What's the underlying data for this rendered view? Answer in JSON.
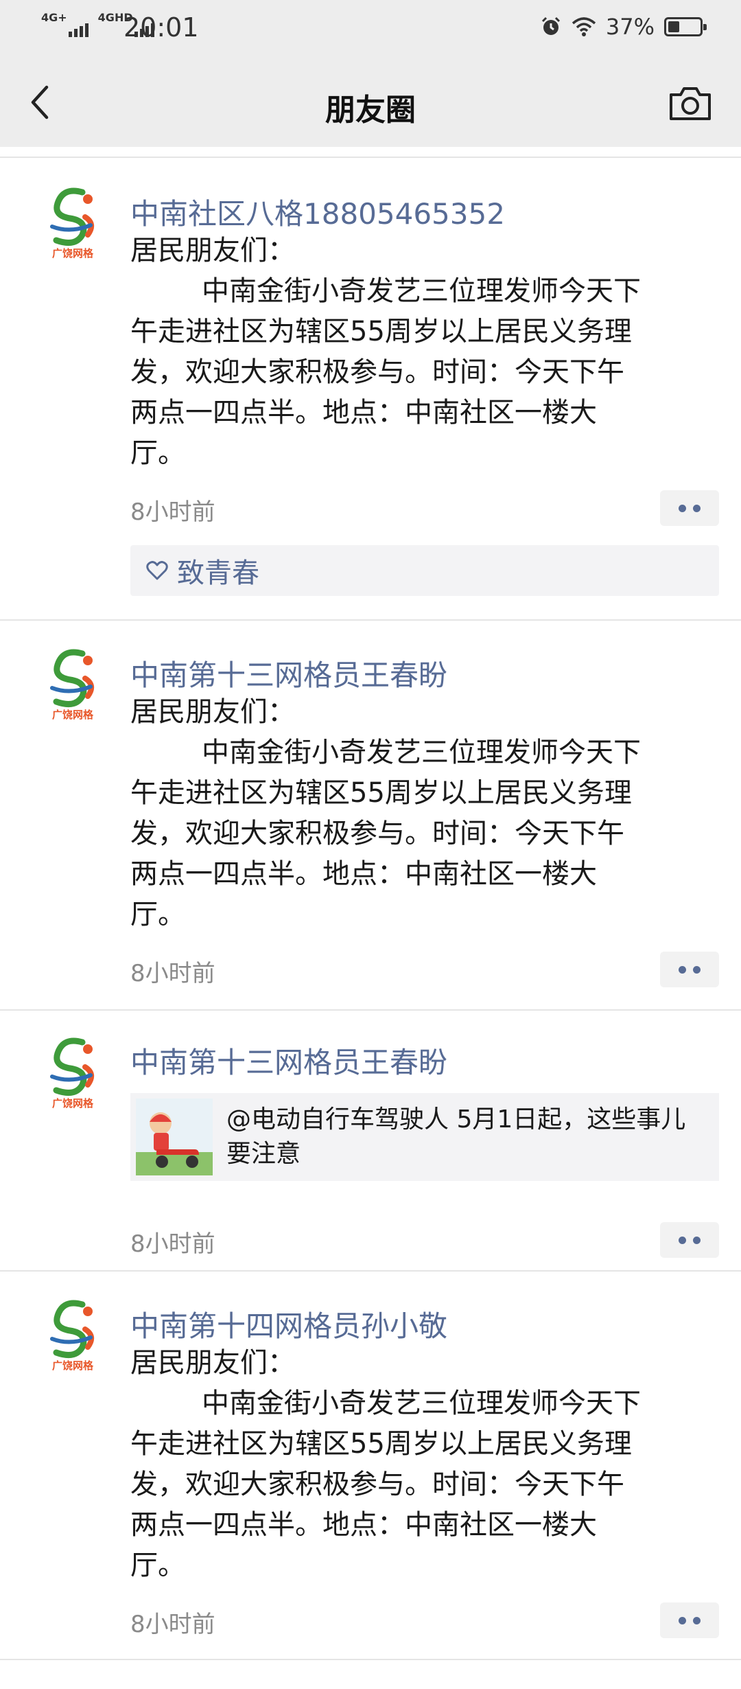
{
  "status_bar": {
    "network_1": "4G+",
    "network_2": "4GHD",
    "time": "20:01",
    "battery_percent": "37%",
    "battery_level": 0.37,
    "icons": [
      "alarm-icon",
      "wifi-icon",
      "battery-icon"
    ]
  },
  "nav": {
    "title": "朋友圈",
    "back_icon": "chevron-left-icon",
    "camera_icon": "camera-icon"
  },
  "colors": {
    "author_link": "#576b95",
    "header_bg": "#ededed",
    "timestamp": "#8a8a8a"
  },
  "avatar_text": "广饶网格",
  "posts": [
    {
      "author": "中南社区八格18805465352",
      "greeting": "居民朋友们：",
      "lines": [
        "中南金街小奇发艺三位理发师今天下",
        "午走进社区为辖区55周岁以上居民义务理",
        "发，欢迎大家积极参与。时间：今天下午",
        "两点一四点半。地点：中南社区一楼大",
        "厅。"
      ],
      "time": "8小时前",
      "likes": "致青春"
    },
    {
      "author": "中南第十三网格员王春盼",
      "greeting": "居民朋友们：",
      "lines": [
        "中南金街小奇发艺三位理发师今天下",
        "午走进社区为辖区55周岁以上居民义务理",
        "发，欢迎大家积极参与。时间：今天下午",
        "两点一四点半。地点：中南社区一楼大",
        "厅。"
      ],
      "time": "8小时前"
    },
    {
      "author": "中南第十三网格员王春盼",
      "share_lines": [
        "@电动自行车驾驶人 5月1日起，这些事儿",
        "要注意"
      ],
      "time": "8小时前"
    },
    {
      "author": "中南第十四网格员孙小敬",
      "greeting": "居民朋友们：",
      "lines": [
        "中南金街小奇发艺三位理发师今天下",
        "午走进社区为辖区55周岁以上居民义务理",
        "发，欢迎大家积极参与。时间：今天下午",
        "两点一四点半。地点：中南社区一楼大",
        "厅。"
      ],
      "time": "8小时前"
    }
  ]
}
